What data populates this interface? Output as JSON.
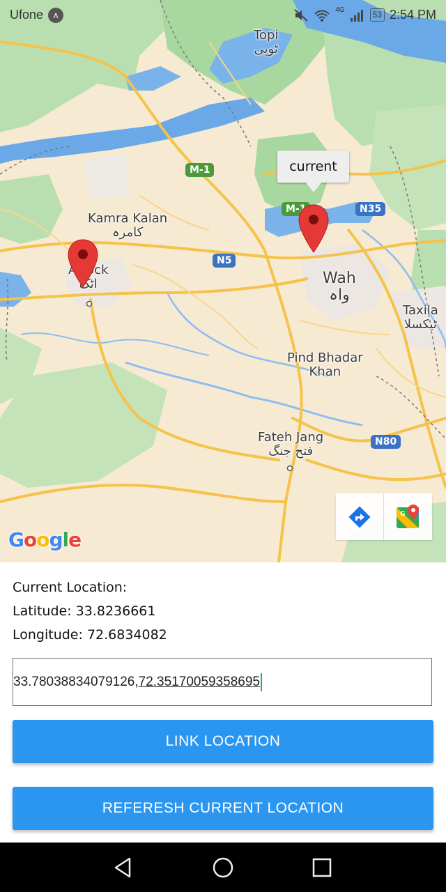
{
  "status_bar": {
    "carrier": "Ufone",
    "carrier_badge": "ʌ",
    "network": "4G",
    "battery": "53",
    "time": "2:54 PM"
  },
  "map": {
    "places": [
      {
        "name": "Topi",
        "urdu": "ٹوپی"
      },
      {
        "name": "Kamra Kalan",
        "urdu": "کامرہ"
      },
      {
        "name": "Attock",
        "urdu": "اٹک"
      },
      {
        "name": "Wah",
        "urdu": "واہ"
      },
      {
        "name": "Taxila",
        "urdu": "ٹیکسلا"
      },
      {
        "name": "Pind Bhadar\nKhan",
        "urdu": ""
      },
      {
        "name": "Fateh Jang",
        "urdu": "فتح جنگ"
      }
    ],
    "road_shields": [
      "M-1",
      "M-1",
      "N35",
      "N5",
      "N80"
    ],
    "info_window_title": "current",
    "attribution": "Google",
    "icons": [
      "directions-icon",
      "google-maps-icon"
    ],
    "colors": {
      "land": "#f7ead2",
      "water": "#6aa8e8",
      "park": "#a8d8a0",
      "road": "#f5c24a",
      "marker": "#e53935"
    }
  },
  "location": {
    "heading": "Current Location:",
    "latitude_label": "Latitude: 33.8236661",
    "longitude_label": "Longitude: 72.6834082"
  },
  "coord_input": {
    "value_part1": "33.78038834079126, ",
    "value_part2": "72.35170059358695"
  },
  "buttons": {
    "link_location": "LINK LOCATION",
    "refresh_location": "REFERESH CURRENT LOCATION"
  },
  "nav": {
    "icons": [
      "back-icon",
      "home-icon",
      "recents-icon"
    ]
  },
  "accent_color": "#2b96f0"
}
